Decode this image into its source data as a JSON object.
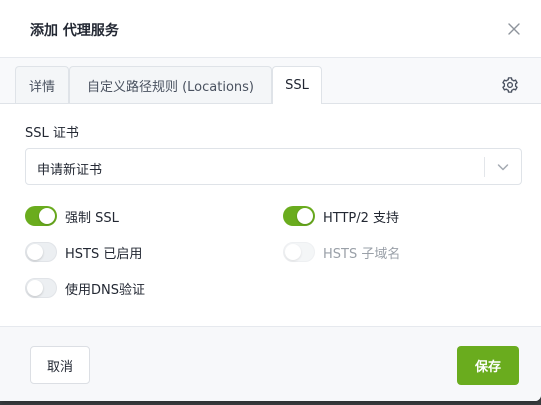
{
  "dialog": {
    "title": "添加 代理服务"
  },
  "tabs": [
    {
      "label": "详情",
      "active": false
    },
    {
      "label": "自定义路径规则 (Locations)",
      "active": false
    },
    {
      "label": "SSL",
      "active": true
    }
  ],
  "ssl": {
    "certificate_label": "SSL 证书",
    "certificate_value": "申请新证书"
  },
  "toggles": {
    "force_ssl": {
      "label": "强制 SSL",
      "on": true,
      "disabled": false
    },
    "http2": {
      "label": "HTTP/2 支持",
      "on": true,
      "disabled": false
    },
    "hsts": {
      "label": "HSTS 已启用",
      "on": false,
      "disabled": false
    },
    "hsts_subdomains": {
      "label": "HSTS 子域名",
      "on": false,
      "disabled": true
    },
    "dns_challenge": {
      "label": "使用DNS验证",
      "on": false,
      "disabled": false
    }
  },
  "footer": {
    "cancel_label": "取消",
    "save_label": "保存"
  },
  "colors": {
    "accent": "#6aac1e",
    "backdrop": "#2d3133"
  },
  "icons": {
    "close": "close-icon",
    "settings": "gear-icon",
    "select": "chevron-down-icon"
  }
}
